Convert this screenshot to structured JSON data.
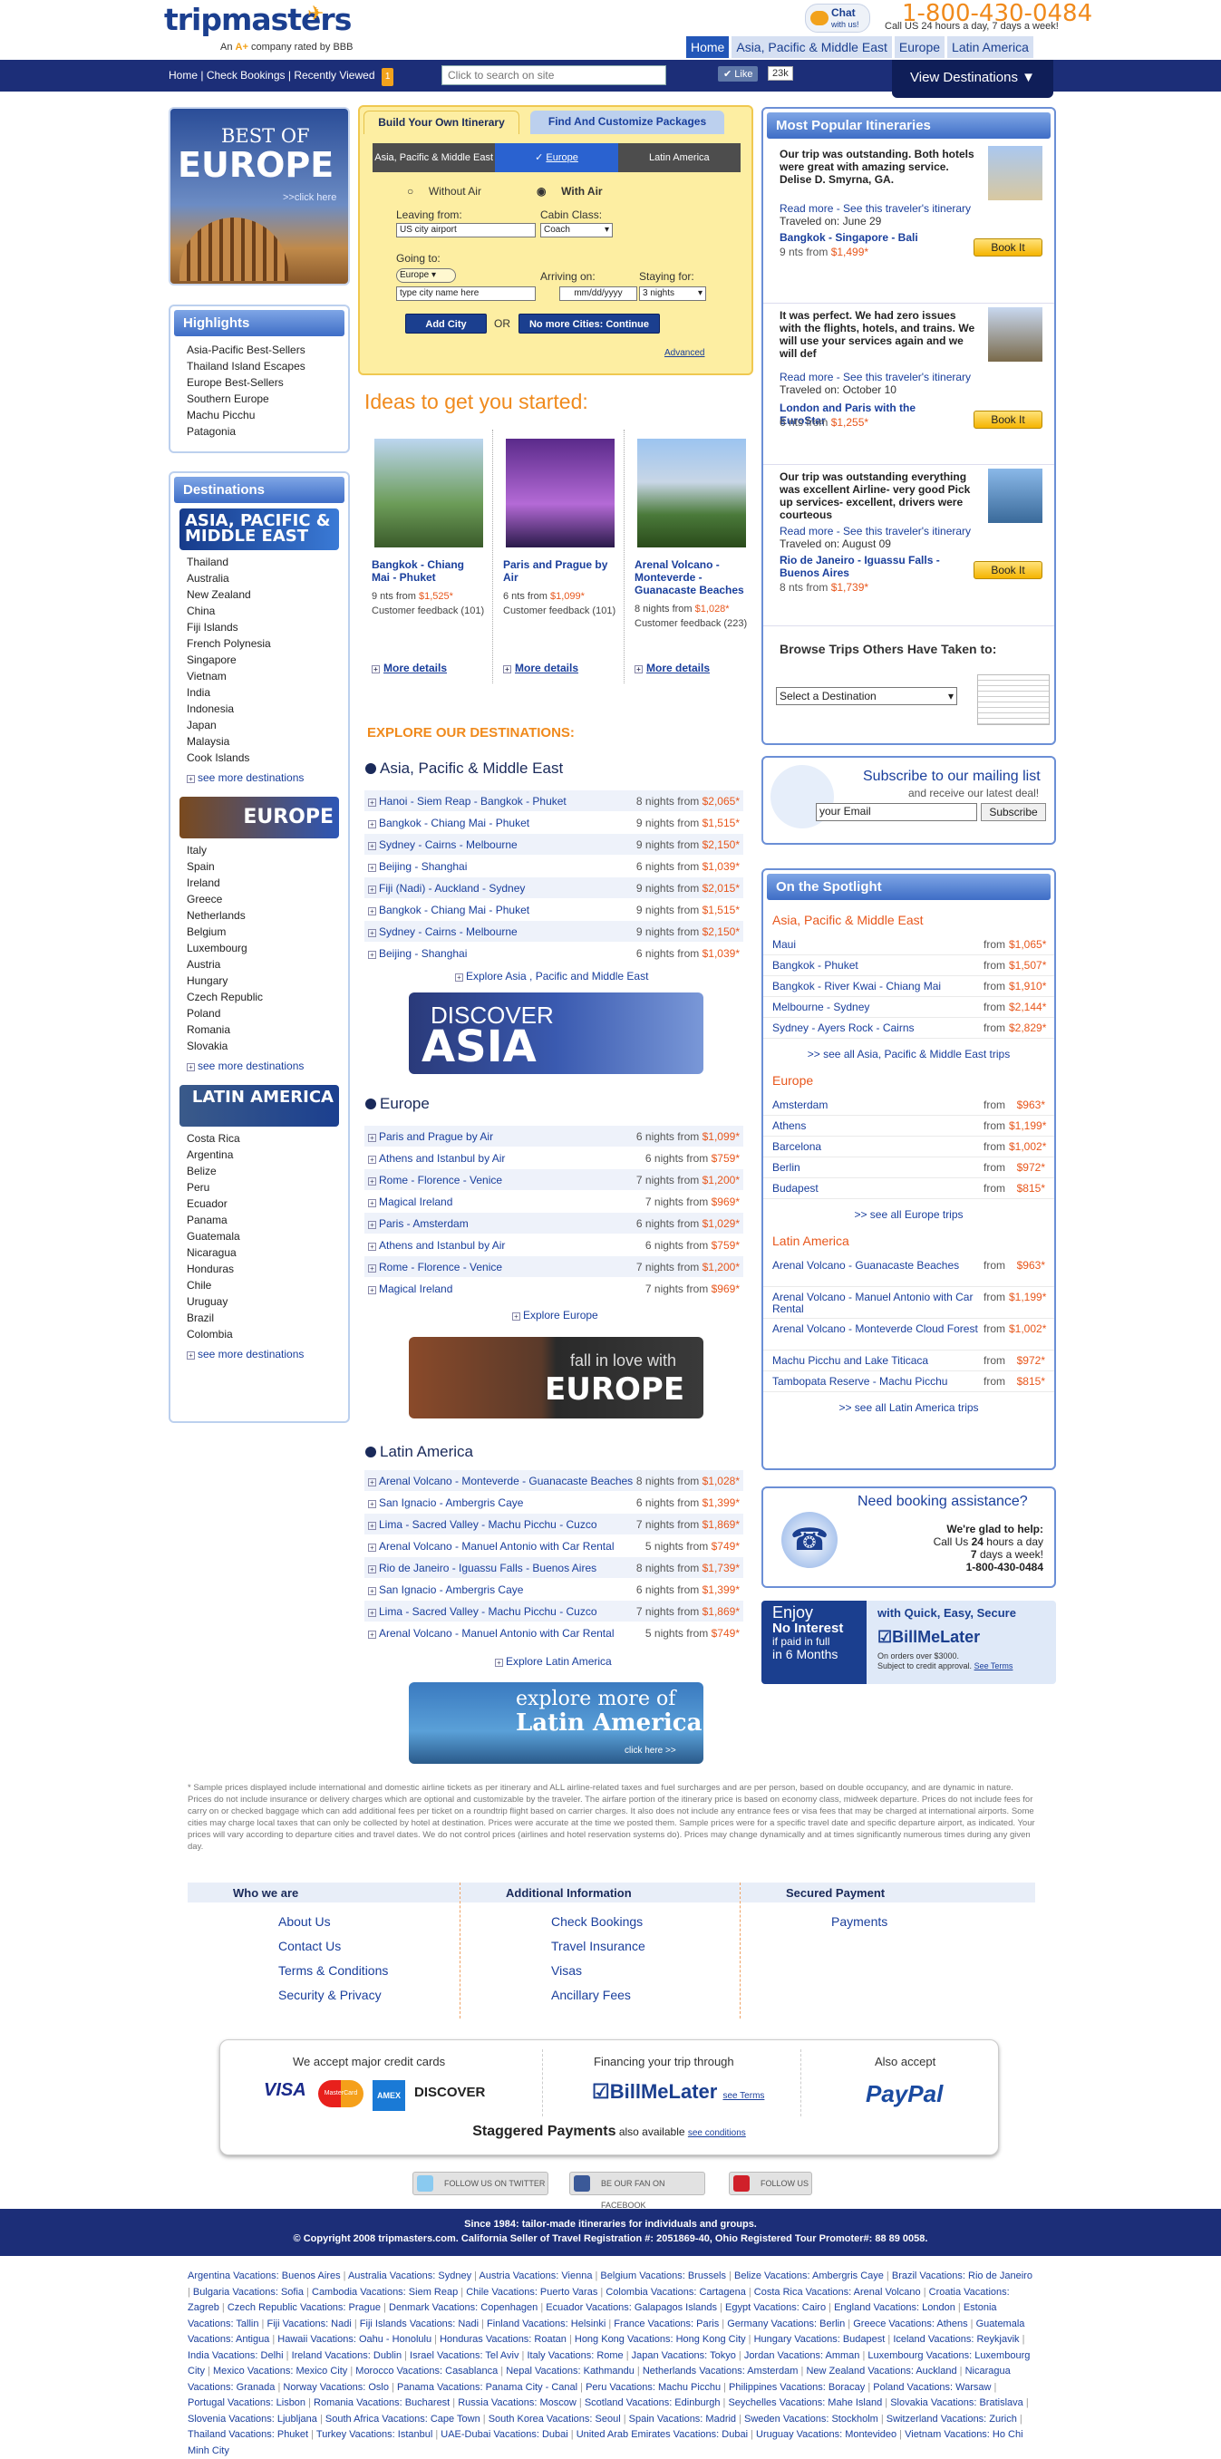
{
  "header": {
    "logo": "tripmasters",
    "tagline_pre": "An",
    "tagline_grade": "A+",
    "tagline_post": "company rated by BBB",
    "chat_label": "Chat",
    "chat_sub": "with us!",
    "phone": "1-800-430-0484",
    "phone_sub": "Call US 24 hours a day, 7 days a week!",
    "tabs": [
      "Home",
      "Asia, Pacific & Middle East",
      "Europe",
      "Latin America"
    ]
  },
  "nav": {
    "home": "Home",
    "check_bookings": "Check Bookings",
    "recently_viewed": "Recently Viewed",
    "recent_count": "1",
    "search_placeholder": "Click to search on site",
    "like": "Like",
    "like_count": "23k",
    "view_destinations": "View Destinations"
  },
  "left": {
    "bestof_line1": "BEST OF",
    "bestof_line2": "EUROPE",
    "bestof_click": ">>click here",
    "highlights_title": "Highlights",
    "highlights": [
      "Asia-Pacific Best-Sellers",
      "Thailand Island Escapes",
      "Europe Best-Sellers",
      "Southern Europe",
      "Machu Picchu",
      "Patagonia"
    ],
    "destinations_title": "Destinations",
    "asia_banner": "ASIA, PACIFIC & MIDDLE EAST",
    "asia": [
      "Thailand",
      "Australia",
      "New Zealand",
      "China",
      "Fiji Islands",
      "French Polynesia",
      "Singapore",
      "Vietnam",
      "India",
      "Indonesia",
      "Japan",
      "Malaysia",
      "Cook Islands"
    ],
    "europe_banner": "EUROPE",
    "europe": [
      "Italy",
      "Spain",
      "Ireland",
      "Greece",
      "Netherlands",
      "Belgium",
      "Luxembourg",
      "Austria",
      "Hungary",
      "Czech Republic",
      "Poland",
      "Romania",
      "Slovakia"
    ],
    "latin_banner": "LATIN AMERICA",
    "latin": [
      "Costa Rica",
      "Argentina",
      "Belize",
      "Peru",
      "Ecuador",
      "Panama",
      "Guatemala",
      "Nicaragua",
      "Honduras",
      "Chile",
      "Uruguay",
      "Brazil",
      "Colombia"
    ],
    "see_more": "see more destinations"
  },
  "booker": {
    "tab1": "Build Your Own Itinerary",
    "tab2": "Find And Customize Packages",
    "regions": [
      "Asia, Pacific & Middle East",
      "Europe",
      "Latin America"
    ],
    "without_air": "Without Air",
    "with_air": "With Air",
    "leaving_from": "Leaving from:",
    "leaving_value": "US city airport",
    "cabin_class": "Cabin Class:",
    "cabin_value": "Coach",
    "going_to": "Going to:",
    "going_value": "Europe",
    "going_city_placeholder": "type city name here",
    "arriving_on": "Arriving on:",
    "arriving_placeholder": "mm/dd/yyyy",
    "staying_for": "Staying for:",
    "staying_value": "3 nights",
    "add_city": "Add City",
    "or": "OR",
    "continue": "No more Cities: Continue",
    "advanced": "Advanced"
  },
  "ideas": {
    "title": "Ideas to get you started:",
    "items": [
      {
        "name": "Bangkok - Chiang Mai - Phuket",
        "nights": "9 nts from",
        "price": "$1,525*",
        "feedback": "Customer feedback (101)",
        "details": "More details"
      },
      {
        "name": "Paris and Prague by Air",
        "nights": "6 nts from",
        "price": "$1,099*",
        "feedback": "Customer feedback (101)",
        "details": "More details"
      },
      {
        "name": "Arenal Volcano - Monteverde - Guanacaste Beaches",
        "nights": "8 nights from",
        "price": "$1,028*",
        "feedback": "Customer feedback (223)",
        "details": "More details"
      }
    ]
  },
  "explore": {
    "title": "EXPLORE OUR DESTINATIONS:",
    "asia_title": "Asia, Pacific & Middle East",
    "asia_trips": [
      {
        "name": "Hanoi - Siem Reap - Bangkok - Phuket",
        "nights": "8 nights from",
        "price": "$2,065*"
      },
      {
        "name": "Bangkok - Chiang Mai - Phuket",
        "nights": "9 nights from",
        "price": "$1,515*"
      },
      {
        "name": "Sydney - Cairns - Melbourne",
        "nights": "9 nights from",
        "price": "$2,150*"
      },
      {
        "name": "Beijing - Shanghai",
        "nights": "6 nights from",
        "price": "$1,039*"
      },
      {
        "name": "Fiji (Nadi) - Auckland - Sydney",
        "nights": "9 nights from",
        "price": "$2,015*"
      },
      {
        "name": "Bangkok - Chiang Mai - Phuket",
        "nights": "9 nights from",
        "price": "$1,515*"
      },
      {
        "name": "Sydney - Cairns - Melbourne",
        "nights": "9 nights from",
        "price": "$2,150*"
      },
      {
        "name": "Beijing - Shanghai",
        "nights": "6 nights from",
        "price": "$1,039*"
      }
    ],
    "asia_link": "Explore Asia , Pacific and Middle East",
    "asia_banner_1": "DISCOVER",
    "asia_banner_2": "ASIA",
    "europe_title": "Europe",
    "europe_trips": [
      {
        "name": "Paris and Prague by Air",
        "nights": "6 nights from",
        "price": "$1,099*"
      },
      {
        "name": "Athens and Istanbul by Air",
        "nights": "6 nights from",
        "price": "$759*"
      },
      {
        "name": "Rome - Florence - Venice",
        "nights": "7 nights from",
        "price": "$1,200*"
      },
      {
        "name": "Magical Ireland",
        "nights": "7 nights from",
        "price": "$969*"
      },
      {
        "name": "Paris - Amsterdam",
        "nights": "6 nights from",
        "price": "$1,029*"
      },
      {
        "name": "Athens and Istanbul by Air",
        "nights": "6 nights from",
        "price": "$759*"
      },
      {
        "name": "Rome - Florence - Venice",
        "nights": "7 nights from",
        "price": "$1,200*"
      },
      {
        "name": "Magical Ireland",
        "nights": "7 nights from",
        "price": "$969*"
      }
    ],
    "europe_link": "Explore Europe",
    "europe_banner_1": "fall in love with",
    "europe_banner_2": "EUROPE",
    "latin_title": "Latin America",
    "latin_trips": [
      {
        "name": "Arenal Volcano - Monteverde - Guanacaste Beaches",
        "nights": "8 nights from",
        "price": "$1,028*"
      },
      {
        "name": "San Ignacio - Ambergris Caye",
        "nights": "6 nights from",
        "price": "$1,399*"
      },
      {
        "name": "Lima - Sacred Valley - Machu Picchu - Cuzco",
        "nights": "7 nights from",
        "price": "$1,869*"
      },
      {
        "name": "Arenal Volcano - Manuel Antonio with Car Rental",
        "nights": "5 nights from",
        "price": "$749*"
      },
      {
        "name": "Rio de Janeiro - Iguassu Falls - Buenos Aires",
        "nights": "8 nights from",
        "price": "$1,739*"
      },
      {
        "name": "San Ignacio - Ambergris Caye",
        "nights": "6 nights from",
        "price": "$1,399*"
      },
      {
        "name": "Lima - Sacred Valley - Machu Picchu - Cuzco",
        "nights": "7 nights from",
        "price": "$1,869*"
      },
      {
        "name": "Arenal Volcano - Manuel Antonio with Car Rental",
        "nights": "5 nights from",
        "price": "$749*"
      }
    ],
    "latin_link": "Explore Latin America",
    "latin_banner_1": "explore more of",
    "latin_banner_2": "Latin America",
    "latin_banner_3": "click here >>"
  },
  "popular": {
    "title": "Most Popular Itineraries",
    "items": [
      {
        "quote": "Our trip was outstanding. Both hotels were great with amazing service. Delise D. Smyrna, GA.",
        "read_more": "Read more - See this traveler's itinerary",
        "traveled": "Traveled on: June 29",
        "trip": "Bangkok - Singapore - Bali",
        "nights": "9 nts from",
        "price": "$1,499*",
        "book": "Book It"
      },
      {
        "quote": "It was perfect. We had zero issues with the flights, hotels, and trains. We will use your services again and we will def",
        "read_more": "Read more - See this traveler's itinerary",
        "traveled": "Traveled on: October 10",
        "trip": "London and Paris with the EuroStar",
        "nights": "6 nts from",
        "price": "$1,255*",
        "book": "Book It"
      },
      {
        "quote": "Our trip was outstanding everything was excellent Airline- very good Pick up services- excellent, drivers were courteous",
        "read_more": "Read more - See this traveler's itinerary",
        "traveled": "Traveled on: August 09",
        "trip": "Rio de Janeiro - Iguassu Falls - Buenos Aires",
        "nights": "8 nts from",
        "price": "$1,739*",
        "book": "Book It"
      }
    ],
    "browse_title": "Browse Trips Others Have Taken to:",
    "browse_select": "Select a Destination"
  },
  "mailing": {
    "title": "Subscribe to our mailing list",
    "sub": "and receive our latest deal!",
    "placeholder": "your Email",
    "button": "Subscribe"
  },
  "spotlight": {
    "title": "On the Spotlight",
    "asia_title": "Asia, Pacific & Middle East",
    "asia": [
      {
        "name": "Maui",
        "price": "$1,065*"
      },
      {
        "name": "Bangkok - Phuket",
        "price": "$1,507*"
      },
      {
        "name": "Bangkok - River Kwai - Chiang Mai",
        "price": "$1,910*"
      },
      {
        "name": "Melbourne - Sydney",
        "price": "$2,144*"
      },
      {
        "name": "Sydney - Ayers Rock - Cairns",
        "price": "$2,829*"
      }
    ],
    "asia_see": ">> see all Asia, Pacific & Middle East trips",
    "europe_title": "Europe",
    "europe": [
      {
        "name": "Amsterdam",
        "price": "$963*"
      },
      {
        "name": "Athens",
        "price": "$1,199*"
      },
      {
        "name": "Barcelona",
        "price": "$1,002*"
      },
      {
        "name": "Berlin",
        "price": "$972*"
      },
      {
        "name": "Budapest",
        "price": "$815*"
      }
    ],
    "europe_see": ">> see all Europe trips",
    "latin_title": "Latin America",
    "latin": [
      {
        "name": "Arenal Volcano - Guanacaste Beaches",
        "price": "$963*"
      },
      {
        "name": "Arenal Volcano - Manuel Antonio with Car Rental",
        "price": "$1,199*"
      },
      {
        "name": "Arenal Volcano - Monteverde Cloud Forest",
        "price": "$1,002*"
      },
      {
        "name": "Machu Picchu and Lake Titicaca",
        "price": "$972*"
      },
      {
        "name": "Tambopata Reserve - Machu Picchu",
        "price": "$815*"
      }
    ],
    "latin_see": ">> see all Latin America trips",
    "from": "from"
  },
  "assist": {
    "title": "Need booking assistance?",
    "l1": "We're glad to help:",
    "l2a": "Call Us",
    "l2b": "24",
    "l2c": "hours a day",
    "l3a": "7",
    "l3b": "days a week!",
    "phone": "1-800-430-0484"
  },
  "bml": {
    "enjoy": "Enjoy",
    "no_interest": "No Interest",
    "paid": "if paid in full",
    "months": "in 6 Months",
    "tag": "with Quick, Easy, Secure",
    "brand": "BillMeLater",
    "orders": "On orders over $3000.",
    "subject": "Subject to credit approval.",
    "terms": "See Terms"
  },
  "disclaimer": "* Sample prices displayed include international and domestic airline tickets as per itinerary and ALL airline-related taxes and fuel surcharges and are per person, based on double occupancy, and are dynamic in nature. Prices do not include insurance or delivery charges which are optional and customizable by the traveler. The airfare portion of the itinerary price is based on economy class, midweek departure. Prices do not include fees for carry on or checked baggage which can add additional fees per ticket on a roundtrip flight based on carrier charges. It also does not include any entrance fees or visa fees that may be charged at international airports. Some cities may charge local taxes that can only be collected by hotel at destination. Prices were accurate at the time we posted them. Sample prices were for a specific travel date and specific departure airport, as indicated. Your prices will vary according to departure cities and travel dates. We do not control prices (airlines and hotel reservation systems do). Prices may change dynamically and at times significantly numerous times during any given day.",
  "footer": {
    "col1_title": "Who we are",
    "col1": [
      "About Us",
      "Contact Us",
      "Terms & Conditions",
      "Security & Privacy"
    ],
    "col2_title": "Additional Information",
    "col2": [
      "Check Bookings",
      "Travel Insurance",
      "Visas",
      "Ancillary Fees"
    ],
    "col3_title": "Secured Payment",
    "col3": [
      "Payments"
    ]
  },
  "payment": {
    "cards_title": "We accept major credit cards",
    "cards": [
      "VISA",
      "MasterCard",
      "AMEX",
      "DISCOVER"
    ],
    "financing_title": "Financing your trip through",
    "financing_brand": "BillMeLater",
    "financing_terms": "see Terms",
    "also_title": "Also accept",
    "paypal": "PayPal",
    "staggered_bold": "Staggered Payments",
    "staggered_rest": "also available",
    "staggered_link": "see conditions"
  },
  "social": {
    "twitter": "FOLLOW US ON TWITTER",
    "facebook": "BE OUR FAN ON FACEBOOK",
    "pinterest": "FOLLOW US"
  },
  "bottom": {
    "line1": "Since 1984: tailor-made itineraries for individuals and groups.",
    "line2": "© Copyright 2008 tripmasters.com. California Seller of Travel Registration #: 2051869-40, Ohio Registered Tour Promoter#: 88 89 0058."
  },
  "vacations": [
    "Argentina Vacations: Buenos Aires",
    "Australia Vacations: Sydney",
    "Austria Vacations: Vienna",
    "Belgium Vacations: Brussels",
    "Belize Vacations: Ambergris Caye",
    "Brazil Vacations: Rio de Janeiro",
    "Bulgaria Vacations: Sofia",
    "Cambodia Vacations: Siem Reap",
    "Chile Vacations: Puerto Varas",
    "Colombia Vacations: Cartagena",
    "Costa Rica Vacations: Arenal Volcano",
    "Croatia Vacations: Zagreb",
    "Czech Republic Vacations: Prague",
    "Denmark Vacations: Copenhagen",
    "Ecuador Vacations: Galapagos Islands",
    "Egypt Vacations: Cairo",
    "England Vacations: London",
    "Estonia Vacations: Tallin",
    "Fiji Vacations: Nadi",
    "Fiji Islands Vacations: Nadi",
    "Finland Vacations: Helsinki",
    "France Vacations: Paris",
    "Germany Vacations: Berlin",
    "Greece Vacations: Athens",
    "Guatemala Vacations: Antigua",
    "Hawaii Vacations: Oahu - Honolulu",
    "Honduras Vacations: Roatan",
    "Hong Kong Vacations: Hong Kong City",
    "Hungary Vacations: Budapest",
    "Iceland Vacations: Reykjavik",
    "India Vacations: Delhi",
    "Ireland Vacations: Dublin",
    "Israel Vacations: Tel Aviv",
    "Italy Vacations: Rome",
    "Japan Vacations: Tokyo",
    "Jordan Vacations: Amman",
    "Luxembourg Vacations: Luxembourg City",
    "Mexico Vacations: Mexico City",
    "Morocco Vacations: Casablanca",
    "Nepal Vacations: Kathmandu",
    "Netherlands Vacations: Amsterdam",
    "New Zealand Vacations: Auckland",
    "Nicaragua Vacations: Granada",
    "Norway Vacations: Oslo",
    "Panama Vacations: Panama City - Canal",
    "Peru Vacations: Machu Picchu",
    "Philippines Vacations: Boracay",
    "Poland Vacations: Warsaw",
    "Portugal Vacations: Lisbon",
    "Romania Vacations: Bucharest",
    "Russia Vacations: Moscow",
    "Scotland Vacations: Edinburgh",
    "Seychelles Vacations: Mahe Island",
    "Slovakia Vacations: Bratislava",
    "Slovenia Vacations: Ljubljana",
    "South Africa Vacations: Cape Town",
    "South Korea Vacations: Seoul",
    "Spain Vacations: Madrid",
    "Sweden Vacations: Stockholm",
    "Switzerland Vacations: Zurich",
    "Thailand Vacations: Phuket",
    "Turkey Vacations: Istanbul",
    "UAE-Dubai Vacations: Dubai",
    "United Arab Emirates Vacations: Dubai",
    "Uruguay Vacations: Montevideo",
    "Vietnam Vacations: Ho Chi Minh City"
  ]
}
